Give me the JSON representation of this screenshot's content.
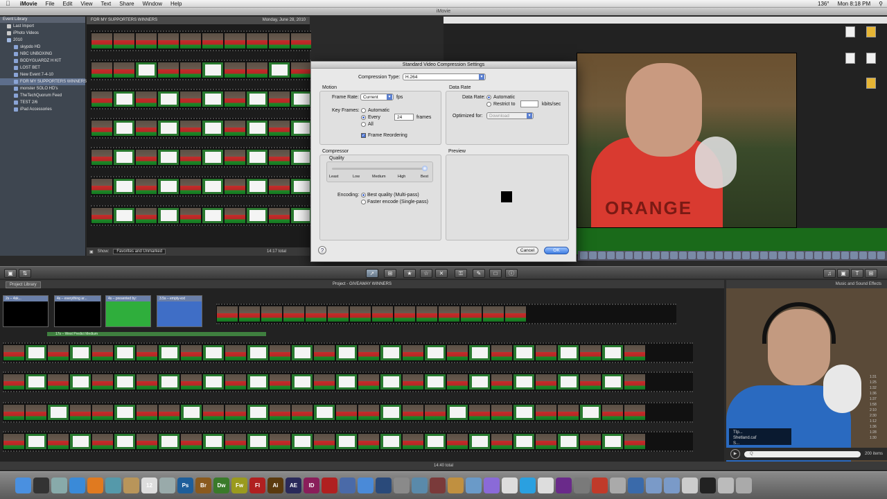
{
  "menubar": {
    "app": "iMovie",
    "items": [
      "File",
      "Edit",
      "View",
      "Text",
      "Share",
      "Window",
      "Help"
    ],
    "battery": "136°",
    "clock": "Mon 8:18 PM"
  },
  "window_title": "iMovie",
  "event_library": {
    "header": "Event Library",
    "items": [
      "Last Import",
      "iPhoto Videos",
      "2010",
      "skypdo HD",
      "NBC UNBOXING",
      "BODYGUARDZ H KIT",
      "LOST BET",
      "New Event 7-4-10",
      "FOR MY SUPPORTERS WINNERS",
      "monster SOLO HD's",
      "TheTechQuorum Feed",
      "TEST 2/6",
      "iPad Accessories"
    ]
  },
  "event_browser": {
    "event_name": "FOR MY SUPPORTERS WINNERS",
    "date": "Monday, June 28, 2010",
    "show_label": "Show:",
    "show_value": "Favorites and Unmarked",
    "total": "14:17 total"
  },
  "dialog": {
    "title": "Standard Video Compression Settings",
    "compression_type_label": "Compression Type:",
    "compression_type": "H.264",
    "motion_label": "Motion",
    "frame_rate_label": "Frame Rate:",
    "frame_rate": "Current",
    "fps": "fps",
    "key_frames_label": "Key Frames:",
    "kf_automatic": "Automatic",
    "kf_every": "Every",
    "kf_every_value": "24",
    "kf_frames": "frames",
    "kf_all": "All",
    "frame_reordering": "Frame Reordering",
    "data_rate_group": "Data Rate",
    "data_rate_label": "Data Rate:",
    "dr_automatic": "Automatic",
    "dr_restrict": "Restrict to",
    "dr_unit": "kbits/sec",
    "optimized_for_label": "Optimized for:",
    "optimized_for": "Download",
    "compressor_label": "Compressor",
    "quality_label": "Quality",
    "quality_ticks": [
      "Least",
      "Low",
      "Medium",
      "High",
      "Best"
    ],
    "quality_level": 1.0,
    "encoding_label": "Encoding:",
    "enc_best": "Best quality (Multi-pass)",
    "enc_faster": "Faster encode (Single-pass)",
    "preview_label": "Preview",
    "help": "?",
    "cancel": "Cancel",
    "ok": "OK"
  },
  "project": {
    "library_button": "Project Library",
    "title": "Project - GIVEAWAY WINNERS",
    "title_clips": [
      {
        "label": "2s – 4sk..."
      },
      {
        "label": "4s – everything ar..."
      },
      {
        "label": "4s – presented by:"
      },
      {
        "label": "3.5s – empty-ext"
      }
    ],
    "audio_label": "17s – West Predict Medium",
    "total": "14:40 total"
  },
  "music": {
    "header": "Music and Sound Effects",
    "items": [
      "TIp...",
      "Shetland.caf",
      "S..."
    ],
    "times": [
      "1:31",
      "1:25",
      "1:32",
      "1:36",
      "1:37",
      "1:58",
      "2:10",
      "2:30",
      "1:12",
      "1:36",
      "1:28",
      "1:30"
    ],
    "count": "200 items",
    "search_placeholder": "Q"
  },
  "colors": {
    "dialog_bg": "#e8e8e8",
    "accent_blue": "#3f7de0",
    "title_clip_green": "#2fae3c",
    "title_clip_blue": "#3f6ec6",
    "shirt_red": "#d93a30"
  },
  "dock": {
    "icons": [
      {
        "name": "finder-icon",
        "label": "",
        "color": "#4a90e0"
      },
      {
        "name": "dashboard-icon",
        "label": "",
        "color": "#333"
      },
      {
        "name": "mail-icon",
        "label": "",
        "color": "#8aa"
      },
      {
        "name": "safari-icon",
        "label": "",
        "color": "#3a8ad8"
      },
      {
        "name": "firefox-icon",
        "label": "",
        "color": "#e07a20"
      },
      {
        "name": "ichat-icon",
        "label": "",
        "color": "#59a"
      },
      {
        "name": "address-book-icon",
        "label": "",
        "color": "#b8955a"
      },
      {
        "name": "ical-icon",
        "label": "12",
        "color": "#ddd"
      },
      {
        "name": "preview-icon",
        "label": "",
        "color": "#9aa"
      },
      {
        "name": "photoshop-icon",
        "label": "Ps",
        "color": "#1e5e9a"
      },
      {
        "name": "bridge-icon",
        "label": "Br",
        "color": "#8a5a1e"
      },
      {
        "name": "dreamweaver-icon",
        "label": "Dw",
        "color": "#3a7a2a"
      },
      {
        "name": "fireworks-icon",
        "label": "Fw",
        "color": "#9a9a1e"
      },
      {
        "name": "flash-icon",
        "label": "Fl",
        "color": "#b02020"
      },
      {
        "name": "illustrator-icon",
        "label": "Ai",
        "color": "#5a3a0e"
      },
      {
        "name": "after-effects-icon",
        "label": "AE",
        "color": "#2a2a5a"
      },
      {
        "name": "indesign-icon",
        "label": "ID",
        "color": "#8a1e5a"
      },
      {
        "name": "acrobat-icon",
        "label": "",
        "color": "#b02020"
      },
      {
        "name": "imovie-icon",
        "label": "",
        "color": "#4a6aa8"
      },
      {
        "name": "itunes-icon",
        "label": "",
        "color": "#4a8ad8"
      },
      {
        "name": "quicktime-icon",
        "label": "",
        "color": "#2a4a7a"
      },
      {
        "name": "compressor-icon",
        "label": "",
        "color": "#8a8a8a"
      },
      {
        "name": "automator-icon",
        "label": "",
        "color": "#5a8aaa"
      },
      {
        "name": "photobooth-icon",
        "label": "",
        "color": "#7a3a3a"
      },
      {
        "name": "garageband-icon",
        "label": "",
        "color": "#c09040"
      },
      {
        "name": "iphoto-icon",
        "label": "",
        "color": "#6a9ac8"
      },
      {
        "name": "aperture-icon",
        "label": "",
        "color": "#8a6ad8"
      },
      {
        "name": "textedit-icon",
        "label": "",
        "color": "#ddd"
      },
      {
        "name": "skype-icon",
        "label": "",
        "color": "#2aa0e0"
      },
      {
        "name": "app-store-icon",
        "label": "",
        "color": "#ddd"
      },
      {
        "name": "motion-icon",
        "label": "",
        "color": "#6a2a8a"
      },
      {
        "name": "system-prefs-icon",
        "label": "",
        "color": "#7a7a7a"
      },
      {
        "name": "pdf-icon",
        "label": "",
        "color": "#c03a2a"
      },
      {
        "name": "utility-icon",
        "label": "",
        "color": "#aaa"
      },
      {
        "name": "network-icon",
        "label": "",
        "color": "#3a6aaa"
      },
      {
        "name": "applications-folder-icon",
        "label": "",
        "color": "#7a9ac8"
      },
      {
        "name": "documents-folder-icon",
        "label": "",
        "color": "#7a9ac8"
      },
      {
        "name": "downloads-stack-icon",
        "label": "",
        "color": "#ccc"
      },
      {
        "name": "terminal-icon",
        "label": "",
        "color": "#222"
      },
      {
        "name": "stack-icon",
        "label": "",
        "color": "#bbb"
      },
      {
        "name": "trash-icon",
        "label": "",
        "color": "#aaa"
      }
    ]
  }
}
